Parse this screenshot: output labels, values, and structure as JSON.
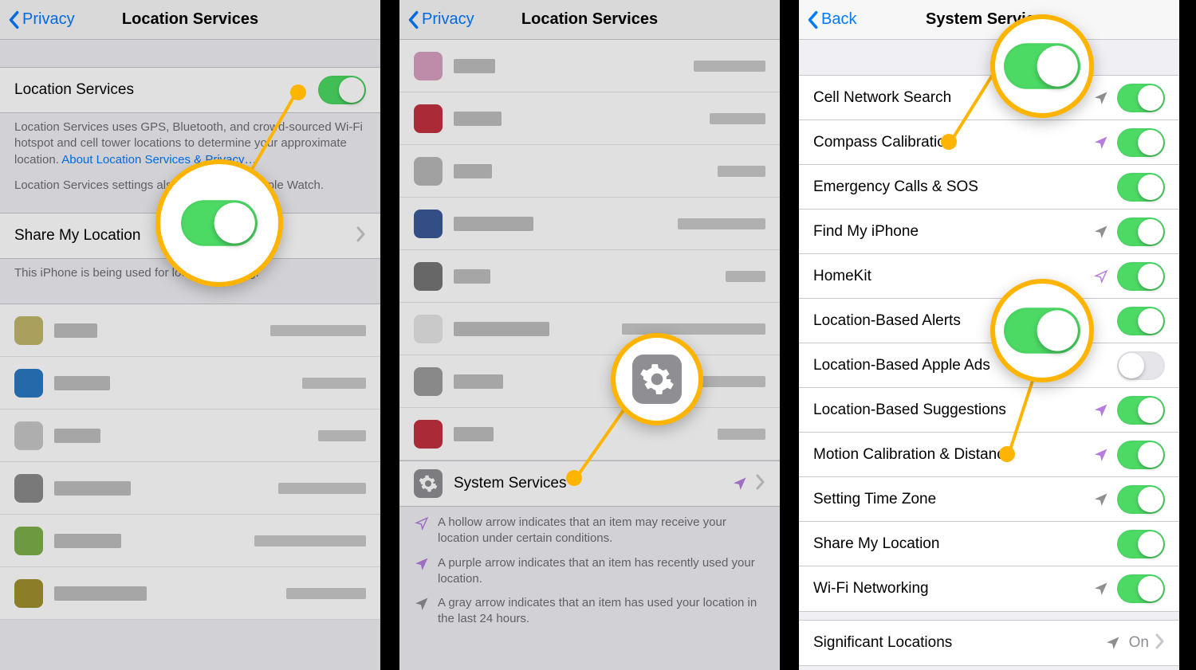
{
  "panel1": {
    "back": "Privacy",
    "title": "Location Services",
    "locServ": "Location Services",
    "desc1": "Location Services uses GPS, Bluetooth, and crowd-sourced Wi-Fi hotspot and cell tower locations to determine your approximate location. ",
    "descLink": "About Location Services & Privacy…",
    "desc2": "Location Services settings also apply to your Apple Watch.",
    "share": "Share My Location",
    "shareFooter": "This iPhone is being used for location sharing.",
    "apps": [
      {
        "color": "#c2b76a",
        "w1": 54,
        "w2": 120
      },
      {
        "color": "#2a78c2",
        "w1": 70,
        "w2": 80
      },
      {
        "color": "#c6c6c6",
        "w1": 58,
        "w2": 60
      },
      {
        "color": "#8a8a8a",
        "w1": 96,
        "w2": 110
      },
      {
        "color": "#7db04b",
        "w1": 84,
        "w2": 140
      },
      {
        "color": "#a08f2f",
        "w1": 116,
        "w2": 100
      }
    ]
  },
  "panel2": {
    "back": "Privacy",
    "title": "Location Services",
    "systemServices": "System Services",
    "legend": [
      {
        "type": "hollow",
        "text": "A hollow arrow indicates that an item may receive your location under certain conditions."
      },
      {
        "type": "purple",
        "text": "A purple arrow indicates that an item has recently used your location."
      },
      {
        "type": "gray",
        "text": "A gray arrow indicates that an item has used your location in the last 24 hours."
      }
    ],
    "apps": [
      {
        "color": "#d8a0c0",
        "w1": 52,
        "w2": 90
      },
      {
        "color": "#c23040",
        "w1": 60,
        "w2": 70
      },
      {
        "color": "#b8b8b8",
        "w1": 48,
        "w2": 60
      },
      {
        "color": "#3b5998",
        "w1": 100,
        "w2": 110
      },
      {
        "color": "#767676",
        "w1": 46,
        "w2": 50
      },
      {
        "color": "#e5e5e5",
        "w1": 120,
        "w2": 180
      },
      {
        "color": "#9d9d9d",
        "w1": 62,
        "w2": 120
      },
      {
        "color": "#c23040",
        "w1": 50,
        "w2": 60
      }
    ]
  },
  "panel3": {
    "back": "Back",
    "title": "System Services",
    "items": [
      {
        "label": "Cell Network Search",
        "arrow": "gray",
        "on": true
      },
      {
        "label": "Compass Calibration",
        "arrow": "purple",
        "on": true
      },
      {
        "label": "Emergency Calls & SOS",
        "arrow": "",
        "on": true
      },
      {
        "label": "Find My iPhone",
        "arrow": "gray",
        "on": true
      },
      {
        "label": "HomeKit",
        "arrow": "hollow",
        "on": true
      },
      {
        "label": "Location-Based Alerts",
        "arrow": "",
        "on": true
      },
      {
        "label": "Location-Based Apple Ads",
        "arrow": "",
        "on": false
      },
      {
        "label": "Location-Based Suggestions",
        "arrow": "purple",
        "on": true
      },
      {
        "label": "Motion Calibration & Distance",
        "arrow": "purple",
        "on": true
      },
      {
        "label": "Setting Time Zone",
        "arrow": "gray",
        "on": true
      },
      {
        "label": "Share My Location",
        "arrow": "",
        "on": true
      },
      {
        "label": "Wi-Fi Networking",
        "arrow": "gray",
        "on": true
      }
    ],
    "sigLoc": {
      "label": "Significant Locations",
      "arrow": "gray",
      "value": "On"
    }
  }
}
